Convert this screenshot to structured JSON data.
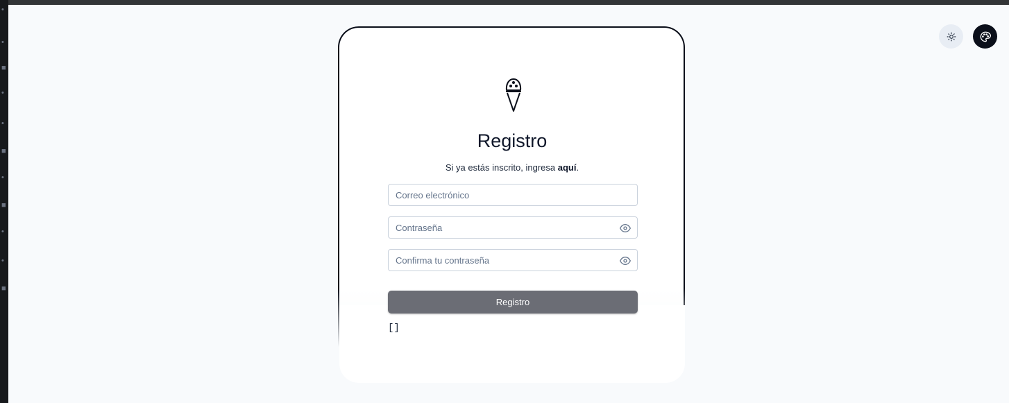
{
  "header": {
    "theme_toggle_icon": "sun-icon",
    "palette_icon": "palette-icon"
  },
  "form": {
    "logo_icon": "ice-cream-icon",
    "title": "Registro",
    "subtitle_text": "Si ya estás inscrito, ingresa ",
    "subtitle_link": "aquí",
    "subtitle_end": ".",
    "email": {
      "placeholder": "Correo electrónico",
      "value": ""
    },
    "password": {
      "placeholder": "Contraseña",
      "value": ""
    },
    "confirm": {
      "placeholder": "Confirma tu contraseña",
      "value": ""
    },
    "submit_label": "Registro",
    "errors_text": "[]"
  },
  "colors": {
    "accent": "#0b0f1a",
    "button": "#6b6d75",
    "background": "#f8fafc"
  }
}
